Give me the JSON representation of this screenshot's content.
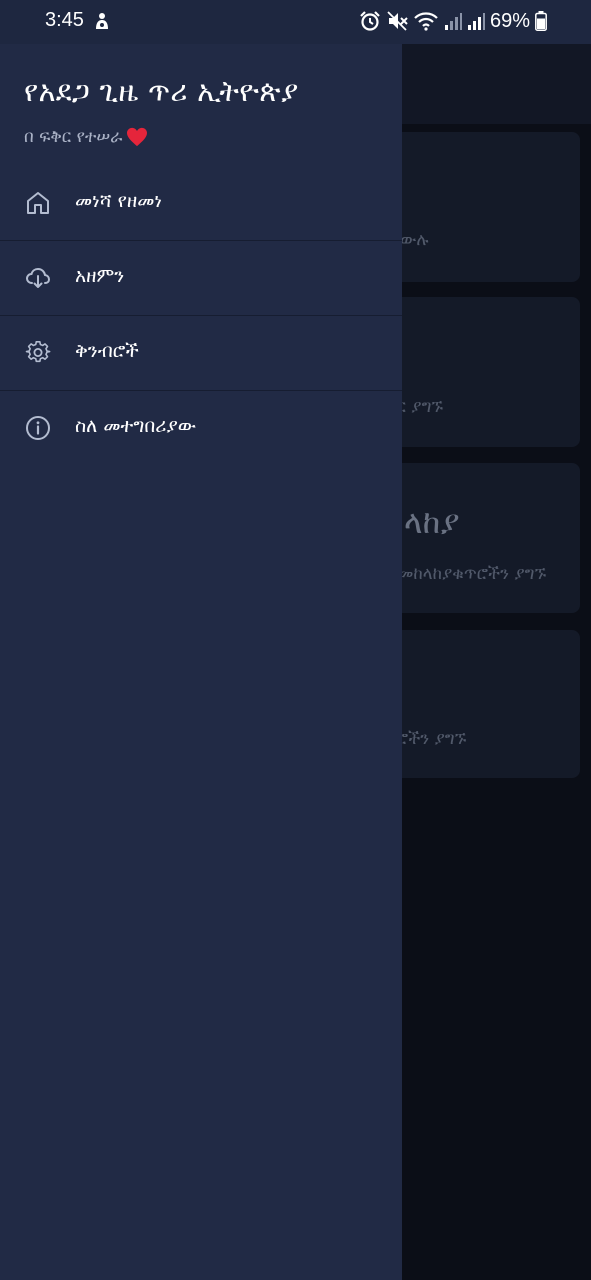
{
  "status_bar": {
    "time": "3:45",
    "battery": "69%",
    "icons": [
      "notification-icon",
      "alarm-icon",
      "mute-icon",
      "wifi-icon",
      "signal-icon",
      "signal-icon",
      "battery-icon"
    ]
  },
  "drawer": {
    "title": "የአደጋ ጊዜ ጥሪ ኢትዮጵያ",
    "subtitle": "በ ፍቅር የተሠራ",
    "items": [
      {
        "label": "መነሻ የዘመነ",
        "icon": "home-icon"
      },
      {
        "label": "አዘምን",
        "icon": "cloud-download-icon"
      },
      {
        "label": "ቅንብሮች",
        "icon": "gear-icon"
      },
      {
        "label": "ስለ መተግበሪያው",
        "icon": "info-icon"
      }
    ]
  },
  "background": {
    "cards": [
      {
        "caption": "ን ይደውሉ"
      },
      {
        "caption": "ቁጥር ያግኙ"
      },
      {
        "heading": "ላከያ",
        "caption": "መከላከያቁጥሮችን ያግኙ"
      },
      {
        "caption": "ጥሮችን ያግኙ"
      }
    ]
  },
  "colors": {
    "drawer_bg": "#212a45",
    "status_bar_bg": "#1e2740",
    "scrim_bg": "#0b0e17",
    "heart": "#e5253b"
  }
}
